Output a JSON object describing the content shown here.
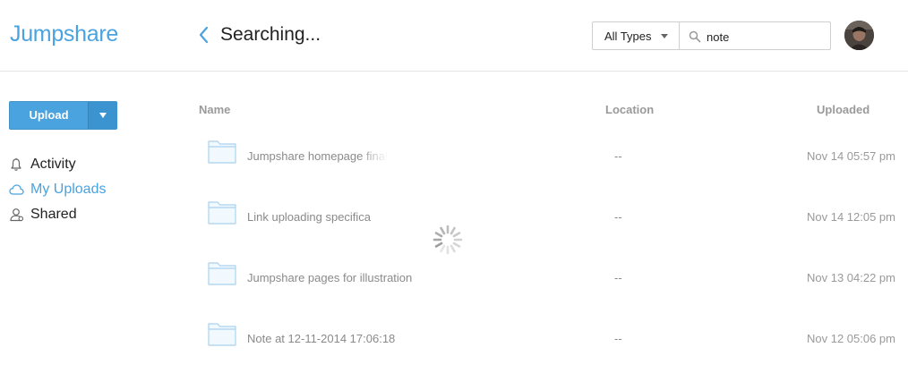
{
  "app": {
    "name": "Jumpshare"
  },
  "header": {
    "title": "Searching...",
    "type_filter": "All Types",
    "search_value": "note"
  },
  "sidebar": {
    "upload_label": "Upload",
    "items": [
      {
        "label": "Activity",
        "icon": "bell-icon",
        "active": false
      },
      {
        "label": "My Uploads",
        "icon": "cloud-icon",
        "active": true
      },
      {
        "label": "Shared",
        "icon": "shared-user-icon",
        "active": false
      }
    ]
  },
  "table": {
    "columns": [
      "Name",
      "Location",
      "Uploaded"
    ],
    "rows": [
      {
        "name": "Jumpshare homepage final",
        "location": "--",
        "uploaded": "Nov 14 05:57 pm"
      },
      {
        "name": "Link uploading specifica",
        "location": "--",
        "uploaded": "Nov 14 12:05 pm"
      },
      {
        "name": "Jumpshare pages for illustration",
        "location": "--",
        "uploaded": "Nov 13 04:22 pm"
      },
      {
        "name": "Note at 12-11-2014 17:06:18",
        "location": "--",
        "uploaded": "Nov 12 05:06 pm"
      }
    ]
  },
  "colors": {
    "accent": "#4aa3df",
    "muted_text": "#8a8a8a",
    "folder_stroke": "#a9d2ef",
    "folder_fill": "#f2f9fe"
  }
}
